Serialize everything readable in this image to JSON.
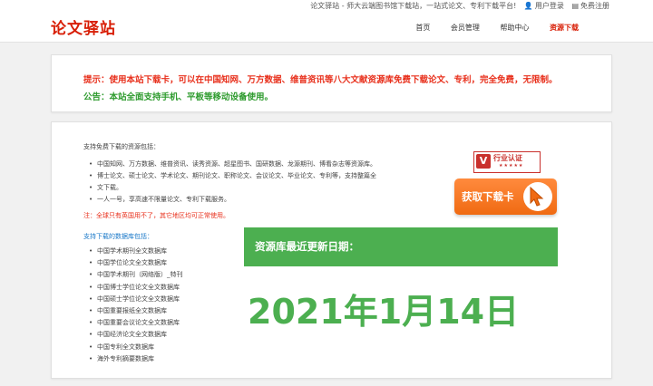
{
  "header": {
    "logo": "论文驿站",
    "tagline": "论文驿站 - 师大云端图书馆下载站，一站式论文、专利下载平台!",
    "user_login": "用户登录",
    "register": "免费注册",
    "nav": [
      {
        "label": "首页",
        "active": false
      },
      {
        "label": "会员管理",
        "active": false
      },
      {
        "label": "帮助中心",
        "active": false
      },
      {
        "label": "资源下载",
        "active": true
      }
    ]
  },
  "notice": {
    "tip": "提示：使用本站下载卡，可以在中国知网、万方数据、维普资讯等八大文献资源库免费下载论文、专利，完全免费，无限制。",
    "announcement": "公告：本站全面支持手机、平板等移动设备使用。"
  },
  "main": {
    "intro": "支持免费下载的资源包括：",
    "resources": [
      "中国知网、万方数据、维普资讯、读秀资源、超星图书、国研数据、龙源期刊、博看杂志等资源库。",
      "博士论文、硕士论文、学术论文、期刊论文、职称论文、会议论文、毕业论文、专利等，支持整篇全",
      "文下载。",
      "一人一号，享高速不限量论文、专利下载服务。"
    ],
    "note": "注：全球只有英国用不了，其它地区均可正常使用。",
    "db_title": "支持下载的数据库包括：",
    "databases": [
      "中国学术期刊全文数据库",
      "中国学位论文全文数据库",
      "中国学术期刊（网络版）_特刊",
      "中国博士学位论文全文数据库",
      "中国硕士学位论文全文数据库",
      "中国重要报纸全文数据库",
      "中国重要会议论文全文数据库",
      "中国经济论文全文数据库",
      "中国专利全文数据库",
      "海外专利摘要数据库"
    ],
    "cert_title": "行业认证",
    "cert_stars": "★★★★★",
    "get_card": "获取下载卡",
    "update_label": "资源库最近更新日期：",
    "update_date": "2021年1月14日"
  },
  "colors": {
    "brand_red": "#d81e06",
    "notice_red": "#e8301c",
    "green": "#4caf50",
    "orange": "#f06a12",
    "link_blue": "#1a78c8"
  }
}
